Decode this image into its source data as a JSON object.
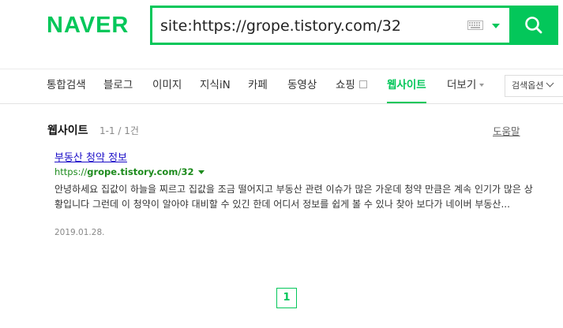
{
  "header": {
    "logo": "NAVER",
    "search_value": "site:https://grope.tistory.com/32",
    "icons": [
      "keyboard-icon",
      "chevron-down-icon",
      "search-icon"
    ]
  },
  "tabs": [
    {
      "label": "통합검색"
    },
    {
      "label": "블로그"
    },
    {
      "label": "이미지"
    },
    {
      "label": "지식iN"
    },
    {
      "label": "카페"
    },
    {
      "label": "동영상"
    },
    {
      "label": "쇼핑"
    },
    {
      "label": "웹사이트",
      "active": true
    },
    {
      "label": "더보기"
    }
  ],
  "search_options": {
    "label": "검색옵션"
  },
  "section": {
    "title": "웹사이트",
    "count": "1-1 / 1건",
    "help": "도움말"
  },
  "result": {
    "title": "부동산 청약 정보",
    "url_prefix": "https://",
    "url_domain": "grope.tistory.com/32",
    "description": "안녕하세요 집값이 하늘을 찌르고 집값을 조금 떨어지고 부동산 관련 이슈가 많은 가운데 청약 만큼은 계속 인기가 많은 상황입니다 그런데 이 청약이 알아야 대비할 수 있긴 한데 어디서 정보를 쉽게 볼 수 있나 찾아 보다가 네이버 부동산...",
    "date": "2019.01.28."
  },
  "pagination": {
    "current": "1"
  },
  "colors": {
    "accent": "#03c75a",
    "link": "#1c0fc8",
    "url": "#1d8b1d"
  }
}
